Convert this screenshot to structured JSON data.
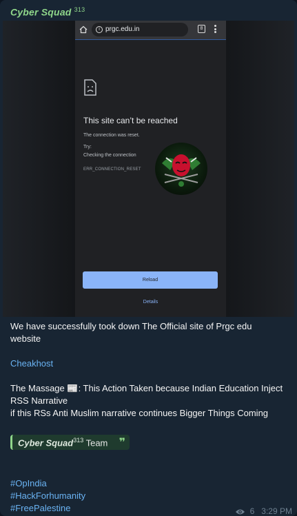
{
  "message": {
    "sender": "Cyber Squad",
    "sender_suffix": "313",
    "media": {
      "url": "prgc.edu.in",
      "tab_count": "8",
      "error_title": "This site can’t be reached",
      "error_message": "The connection was reset.",
      "try_label": "Try:",
      "try_item": "Checking the connection",
      "error_code": "ERR_CONNECTION_RESET",
      "reload_label": "Reload",
      "details_label": "Details"
    },
    "text_line1": "We have successfully took down The Official site of  Prgc edu",
    "text_line2": "website",
    "link_text": "Cheakhost",
    "massage_prefix": "The Massage ",
    "massage_emoji": "📰",
    "massage_rest": ": This Action Taken  because Indian Education  Inject",
    "massage_line2": "RSS Narrative",
    "massage_line3": "if this RSs Anti Muslim narrative continues Bigger Things Coming",
    "quote_name": "Cyber Squad",
    "quote_suffix": "313",
    "quote_rest": " Team",
    "quote_mark": "❞",
    "hashtags": [
      "#OpIndia",
      "#HackForhumanity",
      "#FreePalestine"
    ],
    "views": "6",
    "time": "3:29 PM"
  }
}
